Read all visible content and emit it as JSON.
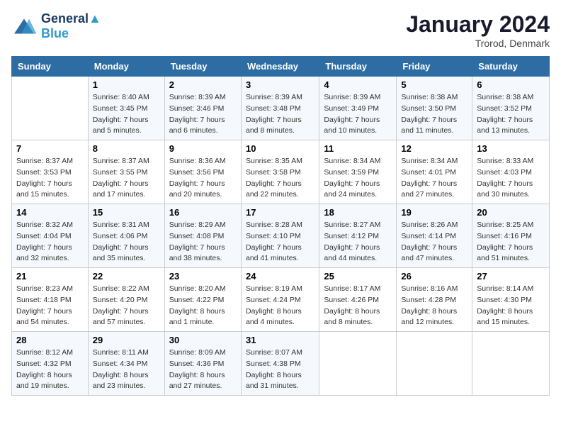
{
  "header": {
    "logo_line1": "General",
    "logo_line2": "Blue",
    "month": "January 2024",
    "location": "Trorod, Denmark"
  },
  "weekdays": [
    "Sunday",
    "Monday",
    "Tuesday",
    "Wednesday",
    "Thursday",
    "Friday",
    "Saturday"
  ],
  "weeks": [
    [
      {
        "day": "",
        "sunrise": "",
        "sunset": "",
        "daylight": ""
      },
      {
        "day": "1",
        "sunrise": "Sunrise: 8:40 AM",
        "sunset": "Sunset: 3:45 PM",
        "daylight": "Daylight: 7 hours and 5 minutes."
      },
      {
        "day": "2",
        "sunrise": "Sunrise: 8:39 AM",
        "sunset": "Sunset: 3:46 PM",
        "daylight": "Daylight: 7 hours and 6 minutes."
      },
      {
        "day": "3",
        "sunrise": "Sunrise: 8:39 AM",
        "sunset": "Sunset: 3:48 PM",
        "daylight": "Daylight: 7 hours and 8 minutes."
      },
      {
        "day": "4",
        "sunrise": "Sunrise: 8:39 AM",
        "sunset": "Sunset: 3:49 PM",
        "daylight": "Daylight: 7 hours and 10 minutes."
      },
      {
        "day": "5",
        "sunrise": "Sunrise: 8:38 AM",
        "sunset": "Sunset: 3:50 PM",
        "daylight": "Daylight: 7 hours and 11 minutes."
      },
      {
        "day": "6",
        "sunrise": "Sunrise: 8:38 AM",
        "sunset": "Sunset: 3:52 PM",
        "daylight": "Daylight: 7 hours and 13 minutes."
      }
    ],
    [
      {
        "day": "7",
        "sunrise": "Sunrise: 8:37 AM",
        "sunset": "Sunset: 3:53 PM",
        "daylight": "Daylight: 7 hours and 15 minutes."
      },
      {
        "day": "8",
        "sunrise": "Sunrise: 8:37 AM",
        "sunset": "Sunset: 3:55 PM",
        "daylight": "Daylight: 7 hours and 17 minutes."
      },
      {
        "day": "9",
        "sunrise": "Sunrise: 8:36 AM",
        "sunset": "Sunset: 3:56 PM",
        "daylight": "Daylight: 7 hours and 20 minutes."
      },
      {
        "day": "10",
        "sunrise": "Sunrise: 8:35 AM",
        "sunset": "Sunset: 3:58 PM",
        "daylight": "Daylight: 7 hours and 22 minutes."
      },
      {
        "day": "11",
        "sunrise": "Sunrise: 8:34 AM",
        "sunset": "Sunset: 3:59 PM",
        "daylight": "Daylight: 7 hours and 24 minutes."
      },
      {
        "day": "12",
        "sunrise": "Sunrise: 8:34 AM",
        "sunset": "Sunset: 4:01 PM",
        "daylight": "Daylight: 7 hours and 27 minutes."
      },
      {
        "day": "13",
        "sunrise": "Sunrise: 8:33 AM",
        "sunset": "Sunset: 4:03 PM",
        "daylight": "Daylight: 7 hours and 30 minutes."
      }
    ],
    [
      {
        "day": "14",
        "sunrise": "Sunrise: 8:32 AM",
        "sunset": "Sunset: 4:04 PM",
        "daylight": "Daylight: 7 hours and 32 minutes."
      },
      {
        "day": "15",
        "sunrise": "Sunrise: 8:31 AM",
        "sunset": "Sunset: 4:06 PM",
        "daylight": "Daylight: 7 hours and 35 minutes."
      },
      {
        "day": "16",
        "sunrise": "Sunrise: 8:29 AM",
        "sunset": "Sunset: 4:08 PM",
        "daylight": "Daylight: 7 hours and 38 minutes."
      },
      {
        "day": "17",
        "sunrise": "Sunrise: 8:28 AM",
        "sunset": "Sunset: 4:10 PM",
        "daylight": "Daylight: 7 hours and 41 minutes."
      },
      {
        "day": "18",
        "sunrise": "Sunrise: 8:27 AM",
        "sunset": "Sunset: 4:12 PM",
        "daylight": "Daylight: 7 hours and 44 minutes."
      },
      {
        "day": "19",
        "sunrise": "Sunrise: 8:26 AM",
        "sunset": "Sunset: 4:14 PM",
        "daylight": "Daylight: 7 hours and 47 minutes."
      },
      {
        "day": "20",
        "sunrise": "Sunrise: 8:25 AM",
        "sunset": "Sunset: 4:16 PM",
        "daylight": "Daylight: 7 hours and 51 minutes."
      }
    ],
    [
      {
        "day": "21",
        "sunrise": "Sunrise: 8:23 AM",
        "sunset": "Sunset: 4:18 PM",
        "daylight": "Daylight: 7 hours and 54 minutes."
      },
      {
        "day": "22",
        "sunrise": "Sunrise: 8:22 AM",
        "sunset": "Sunset: 4:20 PM",
        "daylight": "Daylight: 7 hours and 57 minutes."
      },
      {
        "day": "23",
        "sunrise": "Sunrise: 8:20 AM",
        "sunset": "Sunset: 4:22 PM",
        "daylight": "Daylight: 8 hours and 1 minute."
      },
      {
        "day": "24",
        "sunrise": "Sunrise: 8:19 AM",
        "sunset": "Sunset: 4:24 PM",
        "daylight": "Daylight: 8 hours and 4 minutes."
      },
      {
        "day": "25",
        "sunrise": "Sunrise: 8:17 AM",
        "sunset": "Sunset: 4:26 PM",
        "daylight": "Daylight: 8 hours and 8 minutes."
      },
      {
        "day": "26",
        "sunrise": "Sunrise: 8:16 AM",
        "sunset": "Sunset: 4:28 PM",
        "daylight": "Daylight: 8 hours and 12 minutes."
      },
      {
        "day": "27",
        "sunrise": "Sunrise: 8:14 AM",
        "sunset": "Sunset: 4:30 PM",
        "daylight": "Daylight: 8 hours and 15 minutes."
      }
    ],
    [
      {
        "day": "28",
        "sunrise": "Sunrise: 8:12 AM",
        "sunset": "Sunset: 4:32 PM",
        "daylight": "Daylight: 8 hours and 19 minutes."
      },
      {
        "day": "29",
        "sunrise": "Sunrise: 8:11 AM",
        "sunset": "Sunset: 4:34 PM",
        "daylight": "Daylight: 8 hours and 23 minutes."
      },
      {
        "day": "30",
        "sunrise": "Sunrise: 8:09 AM",
        "sunset": "Sunset: 4:36 PM",
        "daylight": "Daylight: 8 hours and 27 minutes."
      },
      {
        "day": "31",
        "sunrise": "Sunrise: 8:07 AM",
        "sunset": "Sunset: 4:38 PM",
        "daylight": "Daylight: 8 hours and 31 minutes."
      },
      {
        "day": "",
        "sunrise": "",
        "sunset": "",
        "daylight": ""
      },
      {
        "day": "",
        "sunrise": "",
        "sunset": "",
        "daylight": ""
      },
      {
        "day": "",
        "sunrise": "",
        "sunset": "",
        "daylight": ""
      }
    ]
  ]
}
